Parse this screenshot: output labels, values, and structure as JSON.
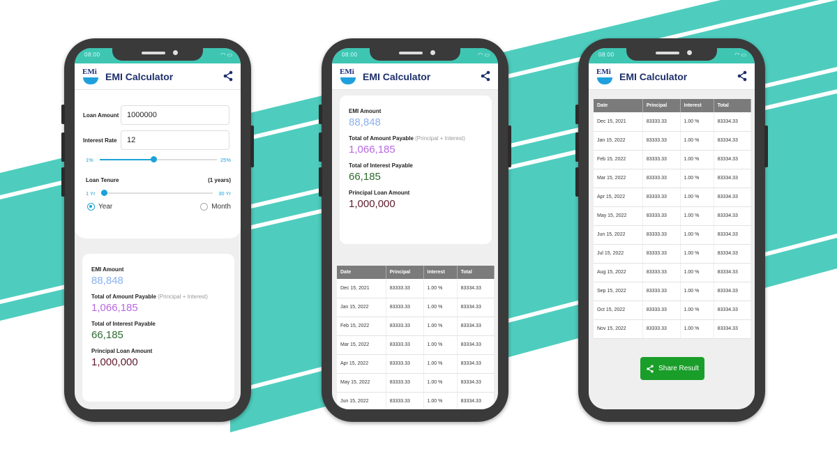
{
  "colors": {
    "accent_teal": "#4ecdbe",
    "emi_color": "#8ab0ee",
    "total_color": "#b768e2",
    "interest_color": "#2c6b2f",
    "principal_color": "#5e1a2e",
    "share_green": "#1a9e2a"
  },
  "status_bar": {
    "time": "08:00"
  },
  "app": {
    "title": "EMI Calculator",
    "logo_text": "EMi"
  },
  "inputs": {
    "loan_amount_label": "Loan Amount",
    "loan_amount_value": "1000000",
    "interest_rate_label": "Interest Rate",
    "interest_rate_value": "12",
    "rate_min": "1%",
    "rate_max": "25%",
    "rate_fraction": 0.46,
    "tenure_label": "Loan Tenure",
    "tenure_value": "(1 years)",
    "tenure_min": "1 Yr",
    "tenure_max": "30 Yr",
    "tenure_fraction": 0.0,
    "year_label": "Year",
    "month_label": "Month"
  },
  "results": {
    "emi_label": "EMI Amount",
    "emi_value": "88,848",
    "total_label": "Total of Amount Payable",
    "total_sub": "(Principal + Interest)",
    "total_value": "1,066,185",
    "interest_label": "Total of Interest Payable",
    "interest_value": "66,185",
    "principal_label": "Principal Loan Amount",
    "principal_value": "1,000,000"
  },
  "table": {
    "headers": [
      "Date",
      "Principal",
      "Interest",
      "Total"
    ],
    "rows": [
      [
        "Dec 15, 2021",
        "83333.33",
        "1.00 %",
        "83334.33"
      ],
      [
        "Jan 15, 2022",
        "83333.33",
        "1.00 %",
        "83334.33"
      ],
      [
        "Feb 15, 2022",
        "83333.33",
        "1.00 %",
        "83334.33"
      ],
      [
        "Mar 15, 2022",
        "83333.33",
        "1.00 %",
        "83334.33"
      ],
      [
        "Apr 15, 2022",
        "83333.33",
        "1.00 %",
        "83334.33"
      ],
      [
        "May 15, 2022",
        "83333.33",
        "1.00 %",
        "83334.33"
      ],
      [
        "Jun 15, 2022",
        "83333.33",
        "1.00 %",
        "83334.33"
      ],
      [
        "Jul 15, 2022",
        "83333.33",
        "1.00 %",
        "83334.33"
      ],
      [
        "Aug 15, 2022",
        "83333.33",
        "1.00 %",
        "83334.33"
      ],
      [
        "Sep 15, 2022",
        "83333.33",
        "1.00 %",
        "83334.33"
      ],
      [
        "Oct 15, 2022",
        "83333.33",
        "1.00 %",
        "83334.33"
      ],
      [
        "Nov 15, 2022",
        "83333.33",
        "1.00 %",
        "83334.33"
      ]
    ]
  },
  "share_button_label": "Share Result",
  "icons": {
    "share": "share-icon",
    "wifi": "wifi-icon",
    "battery": "battery-icon"
  }
}
